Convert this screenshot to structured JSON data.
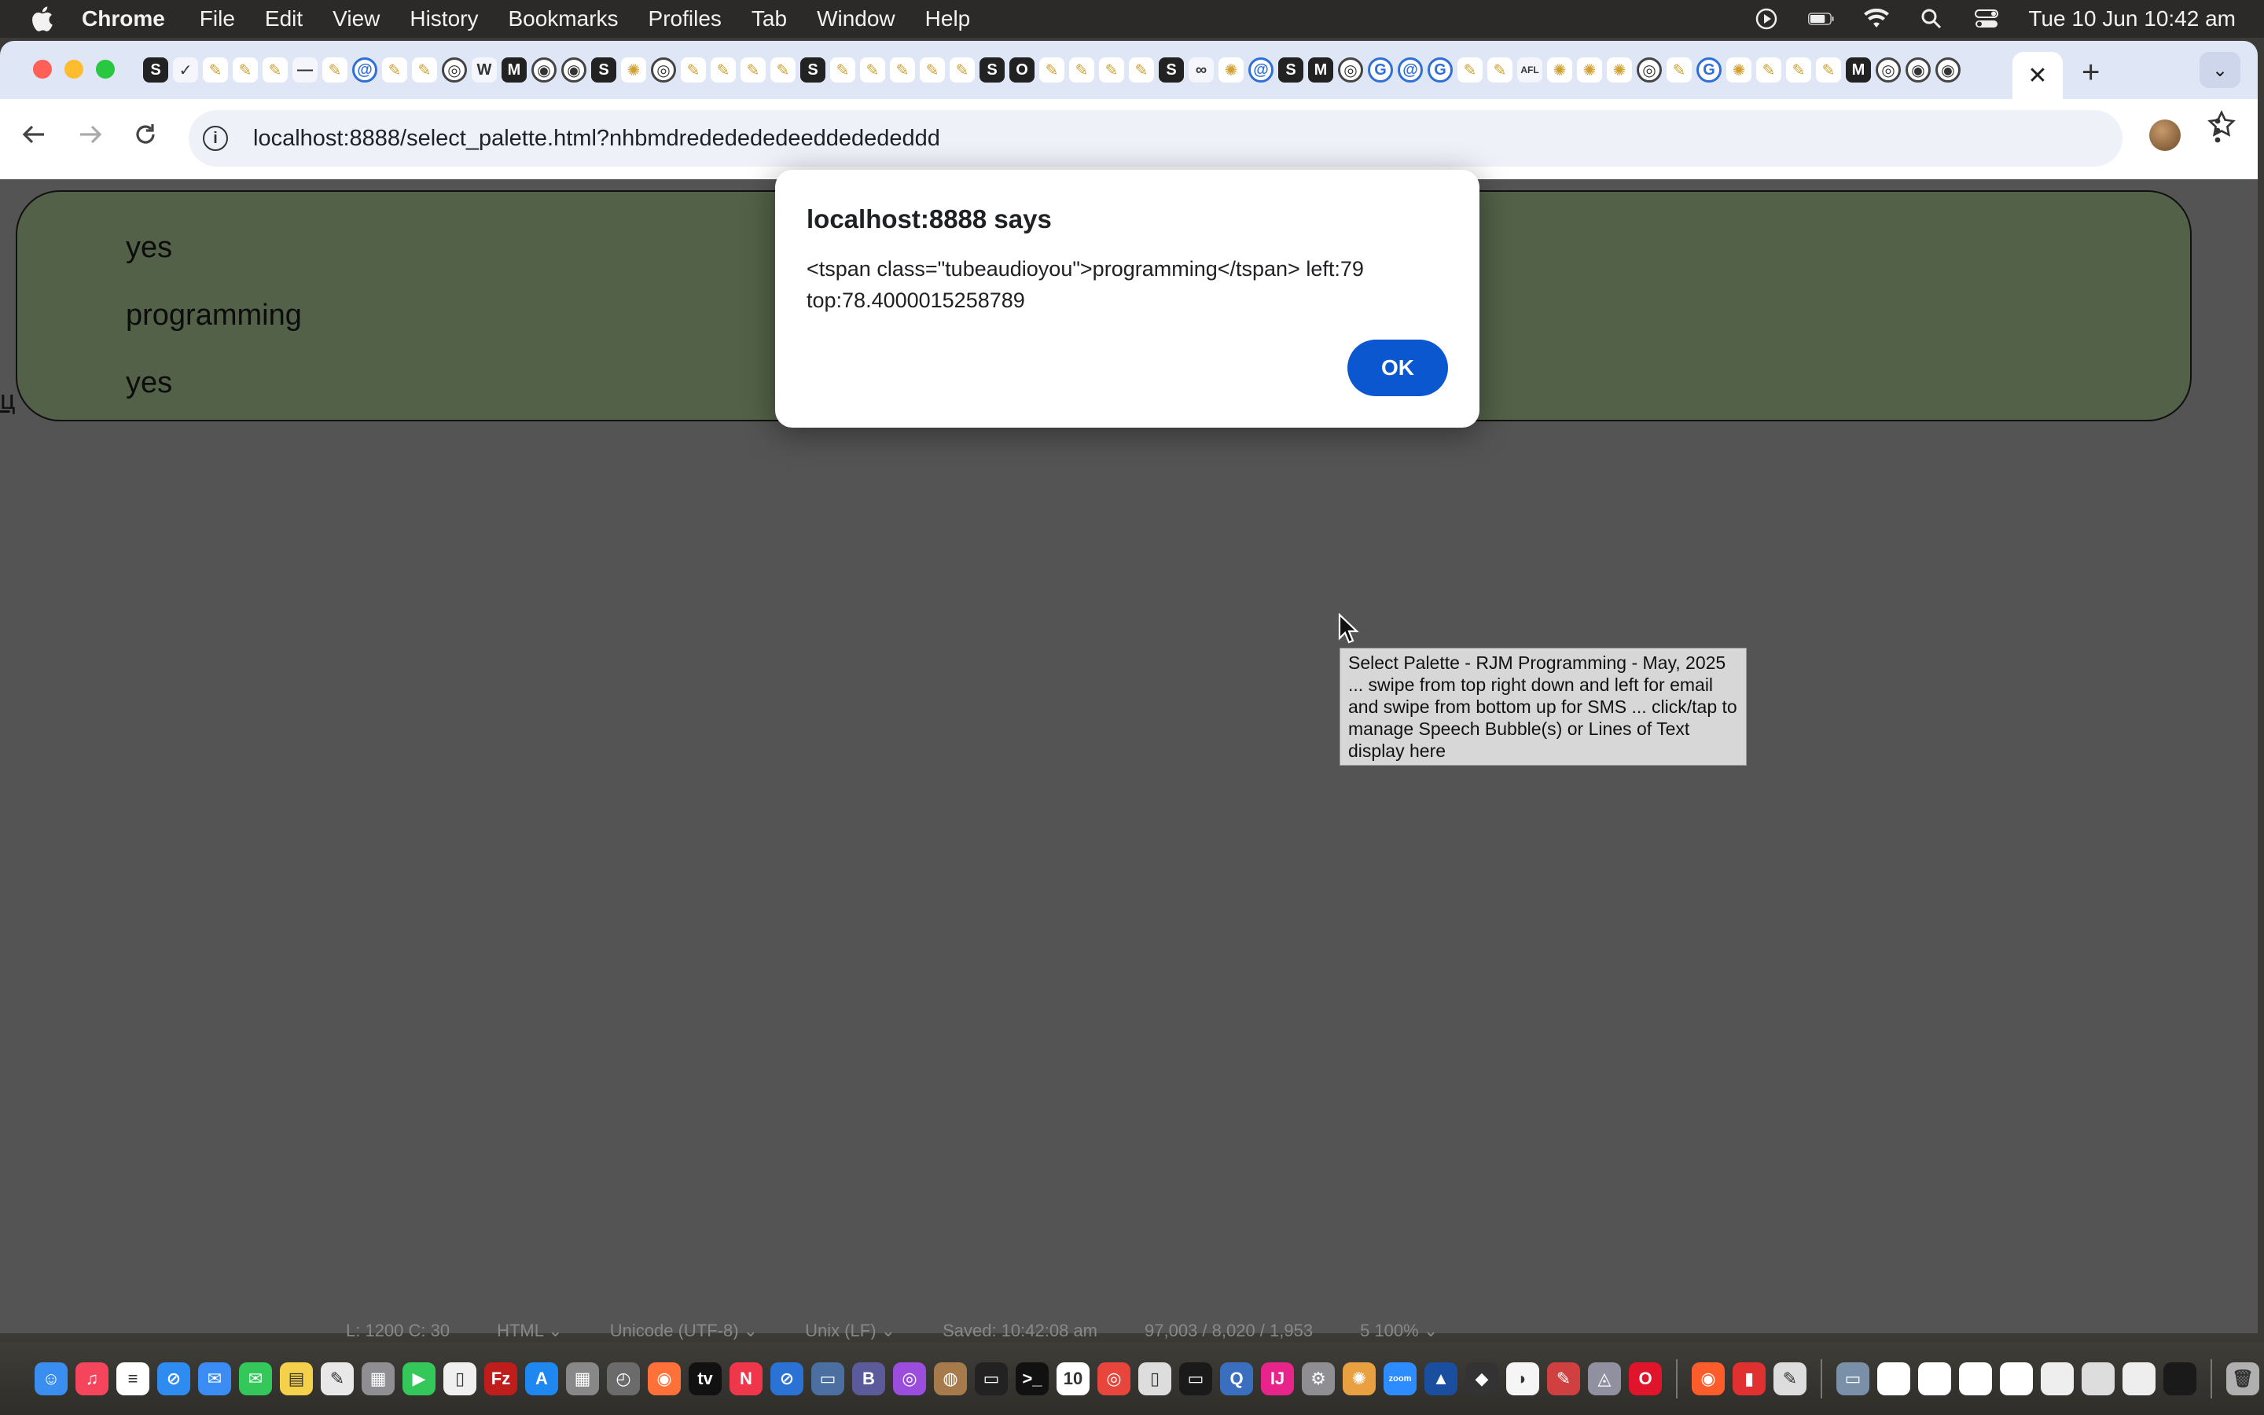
{
  "menubar": {
    "app_name": "Chrome",
    "items": [
      "File",
      "Edit",
      "View",
      "History",
      "Bookmarks",
      "Profiles",
      "Tab",
      "Window",
      "Help"
    ],
    "clock": "Tue 10 Jun  10:42 am",
    "status_icons": [
      "media-play-icon",
      "battery-icon",
      "wifi-icon",
      "spotlight-search-icon",
      "control-center-icon"
    ]
  },
  "browser": {
    "tab_favicons": [
      "S",
      "✓",
      "✎",
      "✎",
      "✎",
      "—",
      "✎",
      "@",
      "✎",
      "✎",
      "◎",
      "W",
      "M",
      "◉",
      "◉",
      "S",
      "✺",
      "◎",
      "✎",
      "✎",
      "✎",
      "✎",
      "S",
      "✎",
      "✎",
      "✎",
      "✎",
      "✎",
      "S",
      "O",
      "✎",
      "✎",
      "✎",
      "✎",
      "S",
      "∞",
      "✺",
      "@",
      "S",
      "M",
      "◎",
      "G",
      "@",
      "G",
      "✎",
      "✎",
      "AFL",
      "✺",
      "✺",
      "✺",
      "◎",
      "✎",
      "G",
      "✺",
      "✎",
      "✎",
      "✎",
      "M",
      "◎",
      "◉",
      "◉"
    ],
    "active_tab_close": "✕",
    "new_tab": "+",
    "tab_search": "⌄",
    "url": "localhost:8888/select_palette.html?nhbmdrededededeeddedededdd"
  },
  "page": {
    "lines": [
      "yes",
      "programming",
      "yes"
    ],
    "corner_glyph": "ц",
    "tooltip": "Select Palette - RJM Programming - May, 2025 ... swipe from top right down and left for email and swipe from bottom up for SMS ... click/tap to manage Speech Bubble(s) or Lines of Text display here",
    "bubble_color": "#526148",
    "page_background": "#545454"
  },
  "dialog": {
    "title": "localhost:8888 says",
    "message": "<tspan class=\"tubeaudioyou\">programming</tspan> left:79 top:78.4000015258789",
    "ok_label": "OK",
    "button_color": "#0b57d0"
  },
  "status_strip": [
    "L: 1200 C: 30",
    "HTML ⌄",
    "Unicode (UTF-8) ⌄",
    "Unix (LF) ⌄",
    "Saved: 10:42:08 am",
    "97,003 / 8,020 / 1,953",
    "5   100% ⌄"
  ],
  "dock": {
    "apps": [
      {
        "name": "finder",
        "glyph": "☺",
        "color": "#3a8ef0"
      },
      {
        "name": "music",
        "glyph": "♫",
        "color": "#f5455c"
      },
      {
        "name": "reminders",
        "glyph": "≡",
        "color": "#ffffff"
      },
      {
        "name": "safari",
        "glyph": "⊘",
        "color": "#2e8bf0"
      },
      {
        "name": "mail",
        "glyph": "✉",
        "color": "#3b8cf5"
      },
      {
        "name": "messages",
        "glyph": "✉",
        "color": "#34c759"
      },
      {
        "name": "notes",
        "glyph": "▤",
        "color": "#f5d04a"
      },
      {
        "name": "freeform",
        "glyph": "✎",
        "color": "#e8e8e8"
      },
      {
        "name": "launchpad",
        "glyph": "▦",
        "color": "#8e8e93"
      },
      {
        "name": "facetime",
        "glyph": "▶",
        "color": "#34c759"
      },
      {
        "name": "textedit",
        "glyph": "▯",
        "color": "#f0f0f0"
      },
      {
        "name": "filezilla",
        "glyph": "Fz",
        "color": "#bf1c1c"
      },
      {
        "name": "app-store",
        "glyph": "A",
        "color": "#1e88f0"
      },
      {
        "name": "calculator",
        "glyph": "▦",
        "color": "#888888"
      },
      {
        "name": "preview",
        "glyph": "◴",
        "color": "#6b6b6b"
      },
      {
        "name": "firefox",
        "glyph": "◉",
        "color": "#ff7139"
      },
      {
        "name": "apple-tv",
        "glyph": "tv",
        "color": "#111111"
      },
      {
        "name": "news",
        "glyph": "N",
        "color": "#f0364a"
      },
      {
        "name": "proxyman",
        "glyph": "⊘",
        "color": "#2a72d4"
      },
      {
        "name": "bluetooth-screen",
        "glyph": "▭",
        "color": "#4a6fa0"
      },
      {
        "name": "bbedit",
        "glyph": "B",
        "color": "#5b5b9b"
      },
      {
        "name": "podcasts",
        "glyph": "◎",
        "color": "#9b4dde"
      },
      {
        "name": "gimp",
        "glyph": "◍",
        "color": "#a77a4b"
      },
      {
        "name": "terminal",
        "glyph": "▭",
        "color": "#222222"
      },
      {
        "name": "terminal-2",
        "glyph": ">_",
        "color": "#111111"
      },
      {
        "name": "calendar",
        "glyph": "10",
        "color": "#ffffff"
      },
      {
        "name": "chrome",
        "glyph": "◎",
        "color": "#e8453c"
      },
      {
        "name": "file",
        "glyph": "▯",
        "color": "#dddddd"
      },
      {
        "name": "console",
        "glyph": "▭",
        "color": "#1a1a1a"
      },
      {
        "name": "quicktime",
        "glyph": "Q",
        "color": "#3a6fc0"
      },
      {
        "name": "intellij",
        "glyph": "IJ",
        "color": "#e8248a"
      },
      {
        "name": "system-settings",
        "glyph": "⚙",
        "color": "#8e8e93"
      },
      {
        "name": "color-picker",
        "glyph": "✺",
        "color": "#e8a040"
      },
      {
        "name": "zoom",
        "glyph": "zoom",
        "color": "#2d8cff"
      },
      {
        "name": "aspect",
        "glyph": "▲",
        "color": "#1a4fa0"
      },
      {
        "name": "inkscape",
        "glyph": "◆",
        "color": "#333333"
      },
      {
        "name": "sequel",
        "glyph": "◗",
        "color": "#f5f5f5"
      },
      {
        "name": "notepad",
        "glyph": "✎",
        "color": "#d04040"
      },
      {
        "name": "vlc",
        "glyph": "◬",
        "color": "#9090a0"
      },
      {
        "name": "opera",
        "glyph": "O",
        "color": "#e0142b"
      },
      {
        "name": "firefox-dev",
        "glyph": "◉",
        "color": "#ff5c2b"
      },
      {
        "name": "filemaker",
        "glyph": "▮",
        "color": "#e03030"
      },
      {
        "name": "script-editor",
        "glyph": "✎",
        "color": "#dddddd"
      },
      {
        "name": "photos-thumb",
        "glyph": "▭",
        "color": "#7a8fa8"
      },
      {
        "name": "window-1",
        "glyph": "",
        "color": "#ffffff"
      },
      {
        "name": "window-2",
        "glyph": "",
        "color": "#ffffff"
      },
      {
        "name": "window-3",
        "glyph": "",
        "color": "#ffffff"
      },
      {
        "name": "window-4",
        "glyph": "",
        "color": "#ffffff"
      },
      {
        "name": "window-5",
        "glyph": "",
        "color": "#eeeeee"
      },
      {
        "name": "window-6",
        "glyph": "",
        "color": "#dddddd"
      },
      {
        "name": "window-7",
        "glyph": "",
        "color": "#eeeeee"
      },
      {
        "name": "terminal-window",
        "glyph": "",
        "color": "#1a1a1a"
      },
      {
        "name": "trash",
        "glyph": "🗑",
        "color": "#b0b0b0"
      }
    ]
  }
}
